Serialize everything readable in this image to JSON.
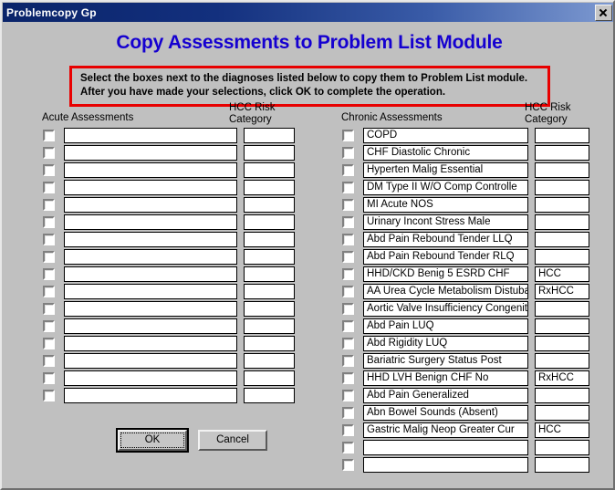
{
  "window": {
    "title": "Problemcopy Gp",
    "close_icon": "close-icon"
  },
  "heading": "Copy Assessments to Problem List Module",
  "instructions": {
    "line1": "Select the boxes next to the diagnoses listed below to copy them to Problem List module.",
    "line2": "After you have made your selections, click OK to complete the operation.",
    "border_color": "#e80000"
  },
  "columns": {
    "acute_label": "Acute Assessments",
    "chronic_label": "Chronic Assessments",
    "hcc_label_line1": "HCC Risk",
    "hcc_label_line2": "Category"
  },
  "acute_rows": [
    {
      "checked": false,
      "name": "",
      "category": ""
    },
    {
      "checked": false,
      "name": "",
      "category": ""
    },
    {
      "checked": false,
      "name": "",
      "category": ""
    },
    {
      "checked": false,
      "name": "",
      "category": ""
    },
    {
      "checked": false,
      "name": "",
      "category": ""
    },
    {
      "checked": false,
      "name": "",
      "category": ""
    },
    {
      "checked": false,
      "name": "",
      "category": ""
    },
    {
      "checked": false,
      "name": "",
      "category": ""
    },
    {
      "checked": false,
      "name": "",
      "category": ""
    },
    {
      "checked": false,
      "name": "",
      "category": ""
    },
    {
      "checked": false,
      "name": "",
      "category": ""
    },
    {
      "checked": false,
      "name": "",
      "category": ""
    },
    {
      "checked": false,
      "name": "",
      "category": ""
    },
    {
      "checked": false,
      "name": "",
      "category": ""
    },
    {
      "checked": false,
      "name": "",
      "category": ""
    },
    {
      "checked": false,
      "name": "",
      "category": ""
    }
  ],
  "chronic_rows": [
    {
      "checked": false,
      "name": "COPD",
      "category": ""
    },
    {
      "checked": false,
      "name": "CHF Diastolic Chronic",
      "category": ""
    },
    {
      "checked": false,
      "name": "Hyperten Malig Essential",
      "category": ""
    },
    {
      "checked": false,
      "name": "DM  Type II W/O Comp Controlle",
      "category": ""
    },
    {
      "checked": false,
      "name": "MI Acute NOS",
      "category": ""
    },
    {
      "checked": false,
      "name": "Urinary Incont Stress Male",
      "category": ""
    },
    {
      "checked": false,
      "name": "Abd Pain Rebound Tender LLQ",
      "category": ""
    },
    {
      "checked": false,
      "name": "Abd Pain Rebound Tender RLQ",
      "category": ""
    },
    {
      "checked": false,
      "name": "HHD/CKD Benig 5 ESRD CHF",
      "category": "HCC"
    },
    {
      "checked": false,
      "name": "AA Urea Cycle Metabolism Distubar",
      "category": "RxHCC"
    },
    {
      "checked": false,
      "name": "Aortic Valve Insufficiency Congenit",
      "category": ""
    },
    {
      "checked": false,
      "name": "Abd Pain LUQ",
      "category": ""
    },
    {
      "checked": false,
      "name": "Abd Rigidity LUQ",
      "category": ""
    },
    {
      "checked": false,
      "name": "Bariatric Surgery Status Post",
      "category": ""
    },
    {
      "checked": false,
      "name": "HHD LVH Benign CHF No",
      "category": "RxHCC"
    },
    {
      "checked": false,
      "name": "Abd Pain Generalized",
      "category": ""
    },
    {
      "checked": false,
      "name": "Abn Bowel Sounds (Absent)",
      "category": ""
    },
    {
      "checked": false,
      "name": "Gastric Malig Neop Greater Cur",
      "category": "HCC"
    },
    {
      "checked": false,
      "name": "",
      "category": ""
    },
    {
      "checked": false,
      "name": "",
      "category": ""
    }
  ],
  "buttons": {
    "ok": "OK",
    "cancel": "Cancel"
  }
}
